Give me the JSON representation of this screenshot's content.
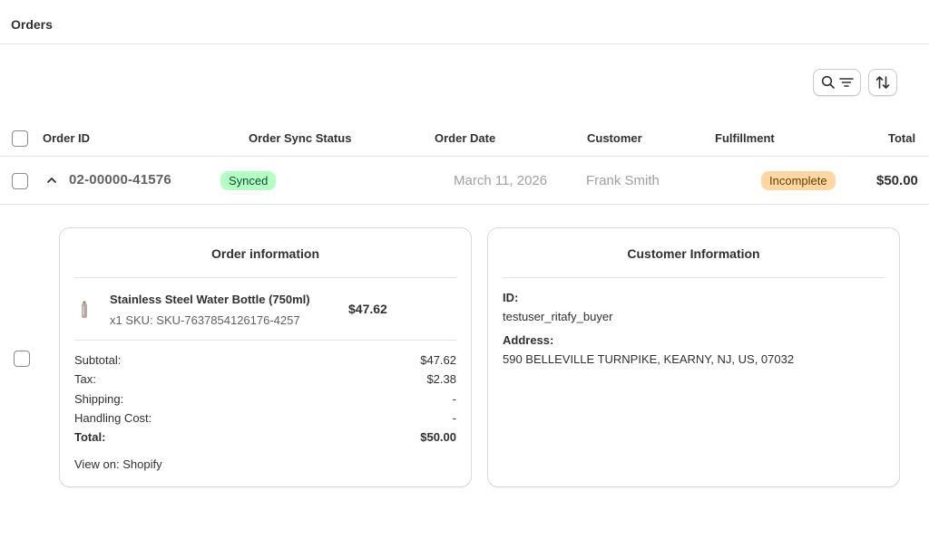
{
  "header": {
    "title": "Orders"
  },
  "toolbar": {
    "search_filter_icon": "search-filter-icon",
    "sort_icon": "sort-icon"
  },
  "table": {
    "columns": [
      "Order ID",
      "Order Sync Status",
      "Order Date",
      "Customer",
      "Fulfillment",
      "Total"
    ],
    "rows": [
      {
        "order_id": "02-00000-41576",
        "sync_status": "Synced",
        "order_date": "March 11, 2026",
        "customer": "Frank Smith",
        "fulfillment": "Incomplete",
        "total": "$50.00"
      }
    ]
  },
  "order_info": {
    "title": "Order information",
    "product": {
      "name": "Stainless Steel Water Bottle (750ml)",
      "sku_line": "x1 SKU: SKU-7637854126176-4257",
      "price": "$47.62"
    },
    "summary": [
      {
        "label": "Subtotal:",
        "value": "$47.62"
      },
      {
        "label": "Tax:",
        "value": "$2.38"
      },
      {
        "label": "Shipping:",
        "value": "-"
      },
      {
        "label": "Handling Cost:",
        "value": "-"
      },
      {
        "label": "Total:",
        "value": "$50.00"
      }
    ],
    "view_on": "View on: Shopify"
  },
  "customer_info": {
    "title": "Customer Information",
    "id_label": "ID:",
    "id_value": "testuser_ritafy_buyer",
    "address_label": "Address:",
    "address_value": "590 BELLEVILLE TURNPIKE, KEARNY, NJ, US, 07032"
  },
  "colors": {
    "synced_bg": "#b4fec4",
    "synced_text": "#0c5132",
    "incomplete_bg": "#ffd6a4",
    "incomplete_text": "#5e4200"
  }
}
